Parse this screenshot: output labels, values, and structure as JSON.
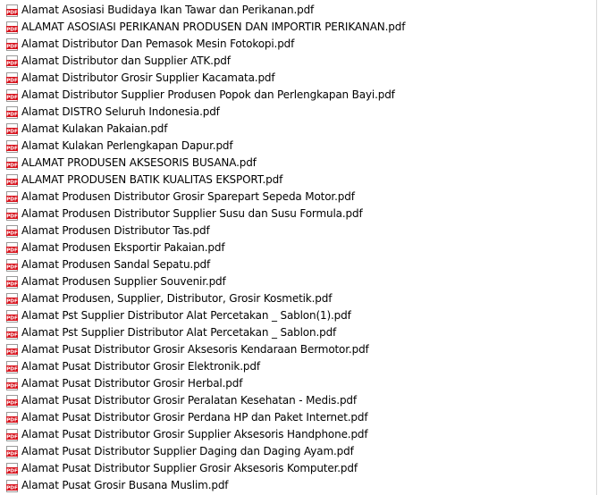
{
  "colors": {
    "pdf_icon_red": "#d6101a",
    "pdf_icon_text": "#ffffff",
    "text": "#000000",
    "background": "#ffffff"
  },
  "files": [
    {
      "name": "Alamat Asosiasi Budidaya Ikan Tawar dan Perikanan.pdf",
      "icon": "pdf-icon"
    },
    {
      "name": "ALAMAT ASOSIASI PERIKANAN PRODUSEN DAN IMPORTIR PERIKANAN.pdf",
      "icon": "pdf-icon"
    },
    {
      "name": "Alamat Distributor Dan Pemasok Mesin Fotokopi.pdf",
      "icon": "pdf-icon"
    },
    {
      "name": "Alamat Distributor dan Supplier ATK.pdf",
      "icon": "pdf-icon"
    },
    {
      "name": "Alamat Distributor Grosir Supplier Kacamata.pdf",
      "icon": "pdf-icon"
    },
    {
      "name": "Alamat Distributor Supplier Produsen Popok dan Perlengkapan Bayi.pdf",
      "icon": "pdf-icon"
    },
    {
      "name": "Alamat DISTRO Seluruh Indonesia.pdf",
      "icon": "pdf-icon"
    },
    {
      "name": "Alamat Kulakan Pakaian.pdf",
      "icon": "pdf-icon"
    },
    {
      "name": "Alamat Kulakan Perlengkapan Dapur.pdf",
      "icon": "pdf-icon"
    },
    {
      "name": "ALAMAT PRODUSEN AKSESORIS BUSANA.pdf",
      "icon": "pdf-icon"
    },
    {
      "name": "ALAMAT PRODUSEN BATIK KUALITAS EKSPORT.pdf",
      "icon": "pdf-icon"
    },
    {
      "name": "Alamat Produsen Distributor Grosir Sparepart Sepeda Motor.pdf",
      "icon": "pdf-icon"
    },
    {
      "name": "Alamat Produsen Distributor Supplier Susu dan Susu Formula.pdf",
      "icon": "pdf-icon"
    },
    {
      "name": "Alamat Produsen Distributor Tas.pdf",
      "icon": "pdf-icon"
    },
    {
      "name": "Alamat Produsen Eksportir Pakaian.pdf",
      "icon": "pdf-icon"
    },
    {
      "name": "Alamat Produsen Sandal Sepatu.pdf",
      "icon": "pdf-icon"
    },
    {
      "name": "Alamat Produsen Supplier Souvenir.pdf",
      "icon": "pdf-icon"
    },
    {
      "name": "Alamat Produsen, Supplier, Distributor, Grosir Kosmetik.pdf",
      "icon": "pdf-icon"
    },
    {
      "name": "Alamat Pst Supplier Distributor Alat Percetakan _ Sablon(1).pdf",
      "icon": "pdf-icon"
    },
    {
      "name": "Alamat Pst Supplier Distributor Alat Percetakan _ Sablon.pdf",
      "icon": "pdf-icon"
    },
    {
      "name": "Alamat Pusat Distributor Grosir Aksesoris Kendaraan Bermotor.pdf",
      "icon": "pdf-icon"
    },
    {
      "name": "Alamat Pusat Distributor Grosir Elektronik.pdf",
      "icon": "pdf-icon"
    },
    {
      "name": "Alamat Pusat Distributor Grosir Herbal.pdf",
      "icon": "pdf-icon"
    },
    {
      "name": "Alamat Pusat Distributor Grosir Peralatan Kesehatan - Medis.pdf",
      "icon": "pdf-icon"
    },
    {
      "name": "Alamat Pusat Distributor Grosir Perdana HP dan Paket Internet.pdf",
      "icon": "pdf-icon"
    },
    {
      "name": "Alamat Pusat Distributor Grosir Supplier Aksesoris Handphone.pdf",
      "icon": "pdf-icon"
    },
    {
      "name": "Alamat Pusat Distributor Supplier Daging dan Daging Ayam.pdf",
      "icon": "pdf-icon"
    },
    {
      "name": "Alamat Pusat Distributor Supplier Grosir Aksesoris Komputer.pdf",
      "icon": "pdf-icon"
    },
    {
      "name": "Alamat Pusat Grosir Busana Muslim.pdf",
      "icon": "pdf-icon"
    }
  ]
}
